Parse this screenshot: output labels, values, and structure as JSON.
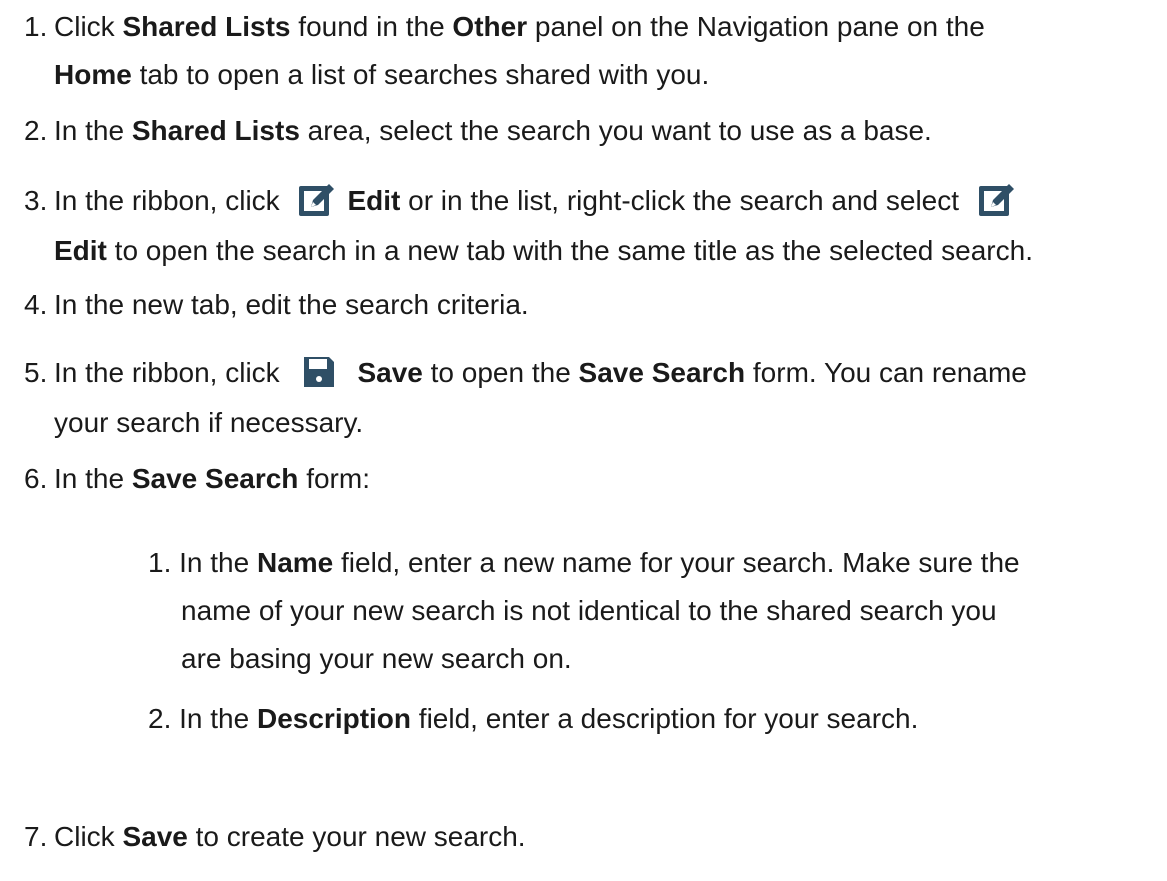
{
  "steps": [
    {
      "n": "1.",
      "parts": [
        "Click ",
        "Shared Lists",
        " found in the ",
        "Other",
        " panel on the Navigation pane on the"
      ],
      "line2": [
        "Home",
        " tab to open a list of searches shared with you."
      ]
    },
    {
      "n": "2.",
      "parts": [
        "In the ",
        "Shared Lists",
        " area, select the search you want to use as a base."
      ]
    },
    {
      "n": "3.",
      "parts": [
        "In the ribbon, click ",
        "Edit",
        " or in the list, right-click the search and select "
      ],
      "line2": [
        "Edit",
        " to open the search in a new tab with the same title as the selected search."
      ],
      "icon": "edit-icon"
    },
    {
      "n": "4.",
      "parts": [
        "In the new tab, edit the search criteria."
      ]
    },
    {
      "n": "5.",
      "parts": [
        "In the ribbon, click ",
        "Save",
        " to open the ",
        "Save Search",
        " form. You can rename"
      ],
      "line2": [
        "your search if necessary."
      ],
      "icon": "save-icon"
    },
    {
      "n": "6.",
      "parts": [
        "In the ",
        "Save Search",
        " form:"
      ]
    },
    {
      "n": "7.",
      "parts": [
        "Click ",
        "Save",
        " to create your new search."
      ]
    }
  ],
  "substeps": [
    {
      "n": "1.",
      "l1": [
        "In the ",
        "Name",
        " field, enter a new name for your search. Make sure the"
      ],
      "l2": "name of your new search is not identical to the shared search you",
      "l3": "are basing your new search on."
    },
    {
      "n": "2.",
      "l1": [
        "In the ",
        "Description",
        " field, enter a description for your search."
      ]
    }
  ],
  "colors": {
    "text": "#1a1a1a",
    "icon": "#2f4f66"
  }
}
